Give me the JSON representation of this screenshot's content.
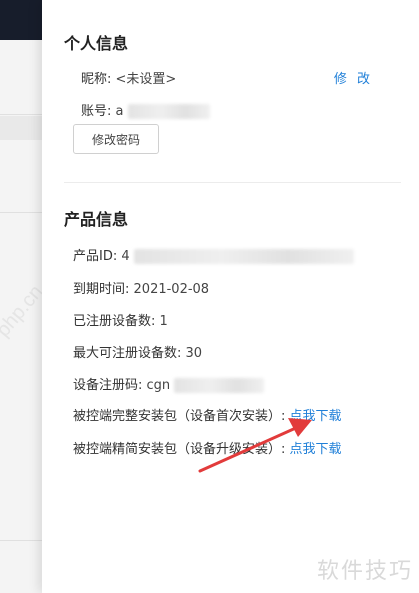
{
  "personal": {
    "title": "个人信息",
    "nickname_label": "昵称:",
    "nickname_value": "<未设置>",
    "edit_label": "修 改",
    "account_label": "账号:",
    "account_value_visible": "a",
    "change_password_label": "修改密码"
  },
  "product": {
    "title": "产品信息",
    "id_label": "产品ID:",
    "id_value_visible": "4",
    "expire_label": "到期时间:",
    "expire_value": "2021-02-08",
    "registered_label": "已注册设备数:",
    "registered_value": "1",
    "max_label": "最大可注册设备数:",
    "max_value": "30",
    "regcode_label": "设备注册码:",
    "regcode_value_visible": "cgn",
    "full_pkg_label": "被控端完整安装包（设备首次安装）:",
    "full_pkg_link": "点我下载",
    "lite_pkg_label": "被控端精简安装包（设备升级安装）:",
    "lite_pkg_link": "点我下载"
  },
  "watermarks": {
    "left": "php.cn",
    "bottom_right": "软件技巧"
  },
  "colors": {
    "link": "#1f7fd8",
    "arrow": "#e23b3b",
    "topbar": "#171d2b"
  }
}
